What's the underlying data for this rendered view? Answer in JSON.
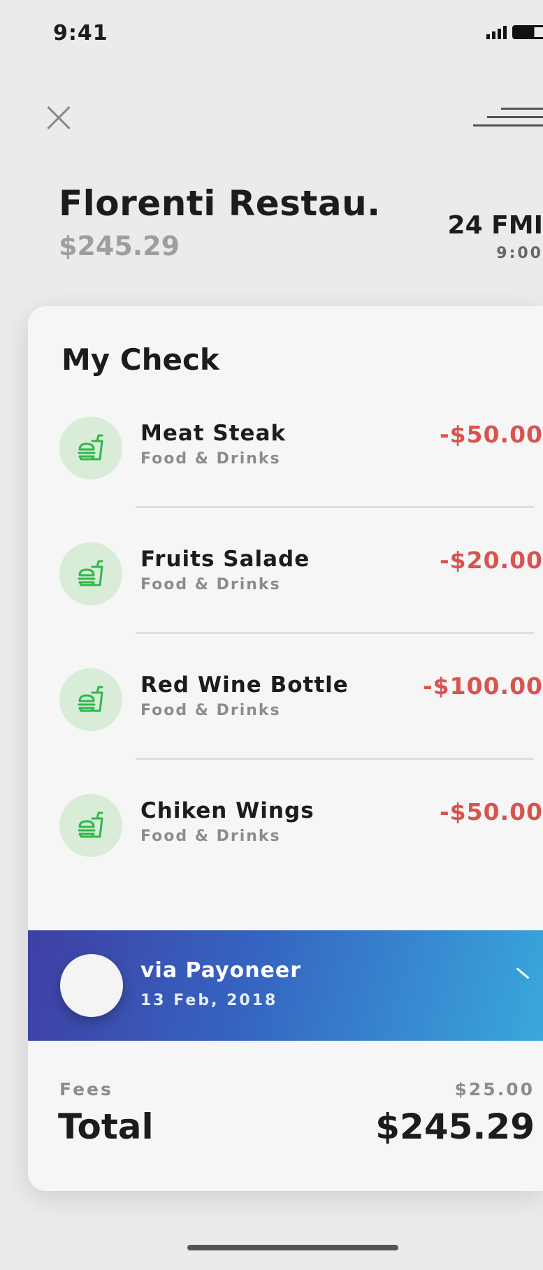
{
  "status_bar": {
    "time": "9:41"
  },
  "header": {
    "restaurant_name": "Florenti Restau.",
    "subtotal": "$245.29",
    "date": "24 FMI",
    "time": "9:00"
  },
  "check": {
    "title": "My Check",
    "items": [
      {
        "name": "Meat Steak",
        "category": "Food & Drinks",
        "amount": "-$50.00"
      },
      {
        "name": "Fruits Salade",
        "category": "Food & Drinks",
        "amount": "-$20.00"
      },
      {
        "name": "Red Wine Bottle",
        "category": "Food & Drinks",
        "amount": "-$100.00"
      },
      {
        "name": "Chiken Wings",
        "category": "Food & Drinks",
        "amount": "-$50.00"
      }
    ],
    "icon": "burger-drink-icon"
  },
  "payment": {
    "title": "via Payoneer",
    "date": "13 Feb, 2018",
    "gradient": [
      "#3f3fa4",
      "#39a8dc"
    ]
  },
  "summary": {
    "fees_label": "Fees",
    "fees_value": "$25.00",
    "total_label": "Total",
    "total_value": "$245.29"
  },
  "colors": {
    "accent_negative": "#d9534f",
    "icon_green": "#2fb84a",
    "icon_bg": "#d8ecd8"
  }
}
